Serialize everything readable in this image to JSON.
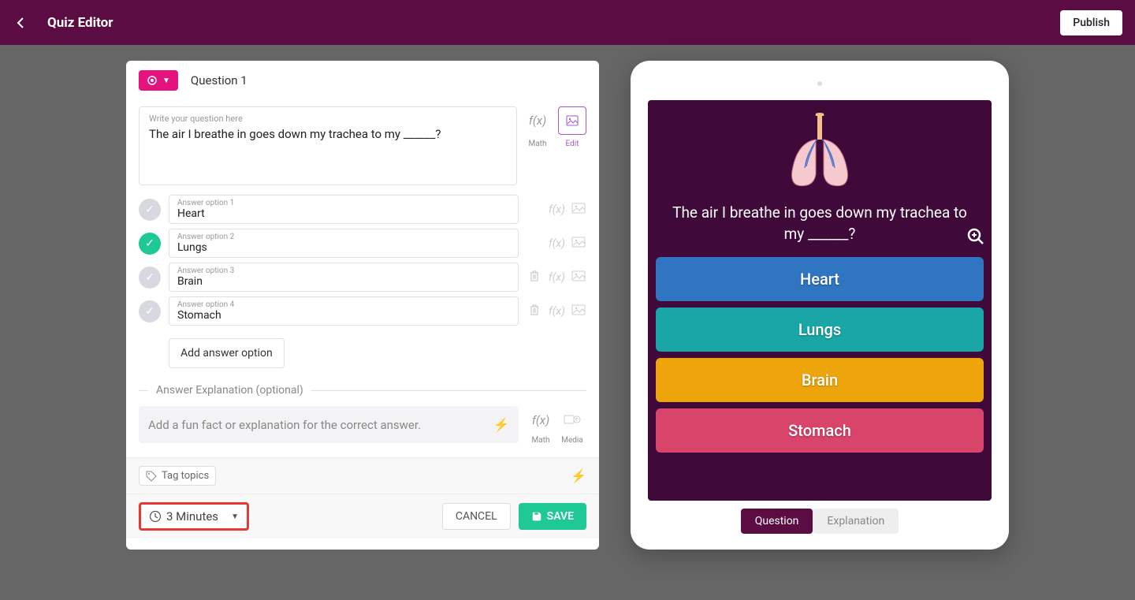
{
  "header": {
    "title": "Quiz Editor",
    "publish": "Publish"
  },
  "editor": {
    "question_number": "Question 1",
    "question_label": "Write your question here",
    "question_text": "The air I breathe in goes down my trachea to my ______?",
    "math_label": "Math",
    "edit_label": "Edit",
    "answers": [
      {
        "label": "Answer option 1",
        "text": "Heart",
        "correct": false,
        "deletable": false
      },
      {
        "label": "Answer option 2",
        "text": "Lungs",
        "correct": true,
        "deletable": false
      },
      {
        "label": "Answer option 3",
        "text": "Brain",
        "correct": false,
        "deletable": true
      },
      {
        "label": "Answer option 4",
        "text": "Stomach",
        "correct": false,
        "deletable": true
      }
    ],
    "add_option": "Add answer option",
    "explanation_label": "Answer Explanation (optional)",
    "explanation_placeholder": "Add a fun fact or explanation for the correct answer.",
    "media_label": "Media",
    "tag_topics": "Tag topics",
    "time": "3 Minutes",
    "cancel": "CANCEL",
    "save": "SAVE"
  },
  "preview": {
    "question": "The air I breathe in goes down my trachea to my ______?",
    "options": [
      "Heart",
      "Lungs",
      "Brain",
      "Stomach"
    ],
    "tab_question": "Question",
    "tab_explanation": "Explanation"
  }
}
